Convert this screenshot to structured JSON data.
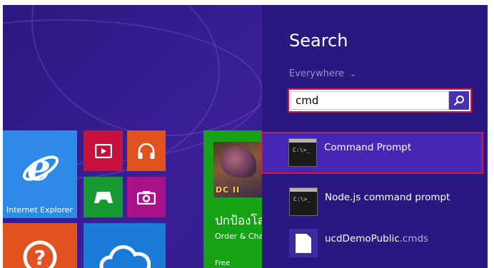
{
  "start": {
    "tiles": [
      {
        "id": "internet-explorer",
        "label": "Internet Explorer",
        "color": "#2e8ae6",
        "icon": "internet-explorer-icon"
      },
      {
        "id": "video",
        "color": "#c4123d",
        "icon": "video-icon"
      },
      {
        "id": "music",
        "color": "#e05321",
        "icon": "headphones-icon"
      },
      {
        "id": "games",
        "color": "#189a32",
        "icon": "game-controller-icon"
      },
      {
        "id": "camera",
        "color": "#a8128a",
        "icon": "camera-icon"
      },
      {
        "id": "help",
        "color": "#e05321",
        "icon": "help-icon"
      },
      {
        "id": "weather",
        "color": "#1a7cd8",
        "icon": "cloud-icon"
      },
      {
        "id": "store-app",
        "color": "#15a215"
      }
    ],
    "store_tile": {
      "game_logo": "DC II",
      "title": "ปกป้องโล",
      "subtitle": "Order & Cha",
      "price": "Free"
    }
  },
  "search": {
    "title": "Search",
    "scope": "Everywhere",
    "query": "cmd",
    "accent_color": "#d31b3a",
    "results": [
      {
        "label": "Command Prompt",
        "icon": "command-prompt-icon",
        "prompt_text": "C:\\>_",
        "selected": true
      },
      {
        "label": "Node.js command prompt",
        "icon": "command-prompt-icon",
        "prompt_text": "C:\\>_",
        "selected": false
      },
      {
        "label_name": "ucdDemoPublic",
        "label_ext": ".cmds",
        "icon": "document-icon",
        "selected": false
      }
    ]
  }
}
